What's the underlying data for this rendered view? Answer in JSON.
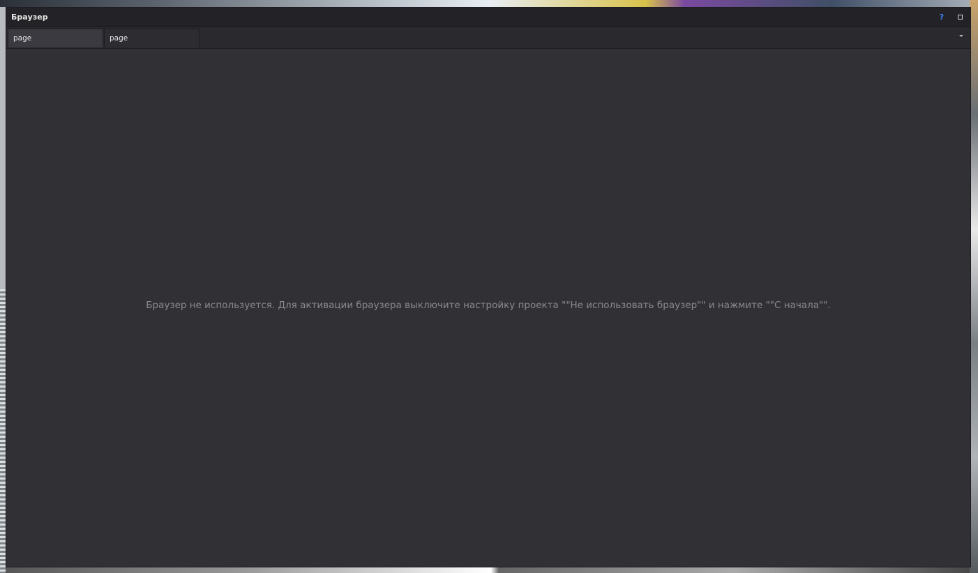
{
  "window": {
    "title": "Браузер"
  },
  "titlebar": {
    "help_label": "?",
    "help_color": "#3b82f6"
  },
  "tabs": [
    {
      "label": "page",
      "active": true
    },
    {
      "label": "page",
      "active": false
    }
  ],
  "content": {
    "message": "Браузер не используется. Для активации браузера выключите настройку проекта \"\"Не использовать браузер\"\" и нажмите \"\"С начала\"\"."
  },
  "colors": {
    "window_bg": "#303035",
    "titlebar_bg": "#232327",
    "message_text": "#8a8a8f"
  }
}
